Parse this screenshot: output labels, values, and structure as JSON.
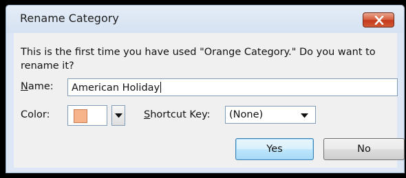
{
  "dialog": {
    "title": "Rename Category",
    "message_line1": "This is the first time you have used \"Orange Category.\" Do you want to",
    "message_line2": "rename it?",
    "name_label": "Name:",
    "name_value": "American Holiday",
    "color_label": "Color:",
    "color_value_hex": "#f7b38a",
    "shortcut_label": "Shortcut Key:",
    "shortcut_value": "(None)",
    "yes_label": "Yes",
    "no_label": "No"
  },
  "icons": {
    "close": "close-icon",
    "color_dropdown": "chevron-down-icon",
    "shortcut_dropdown": "chevron-down-icon"
  }
}
